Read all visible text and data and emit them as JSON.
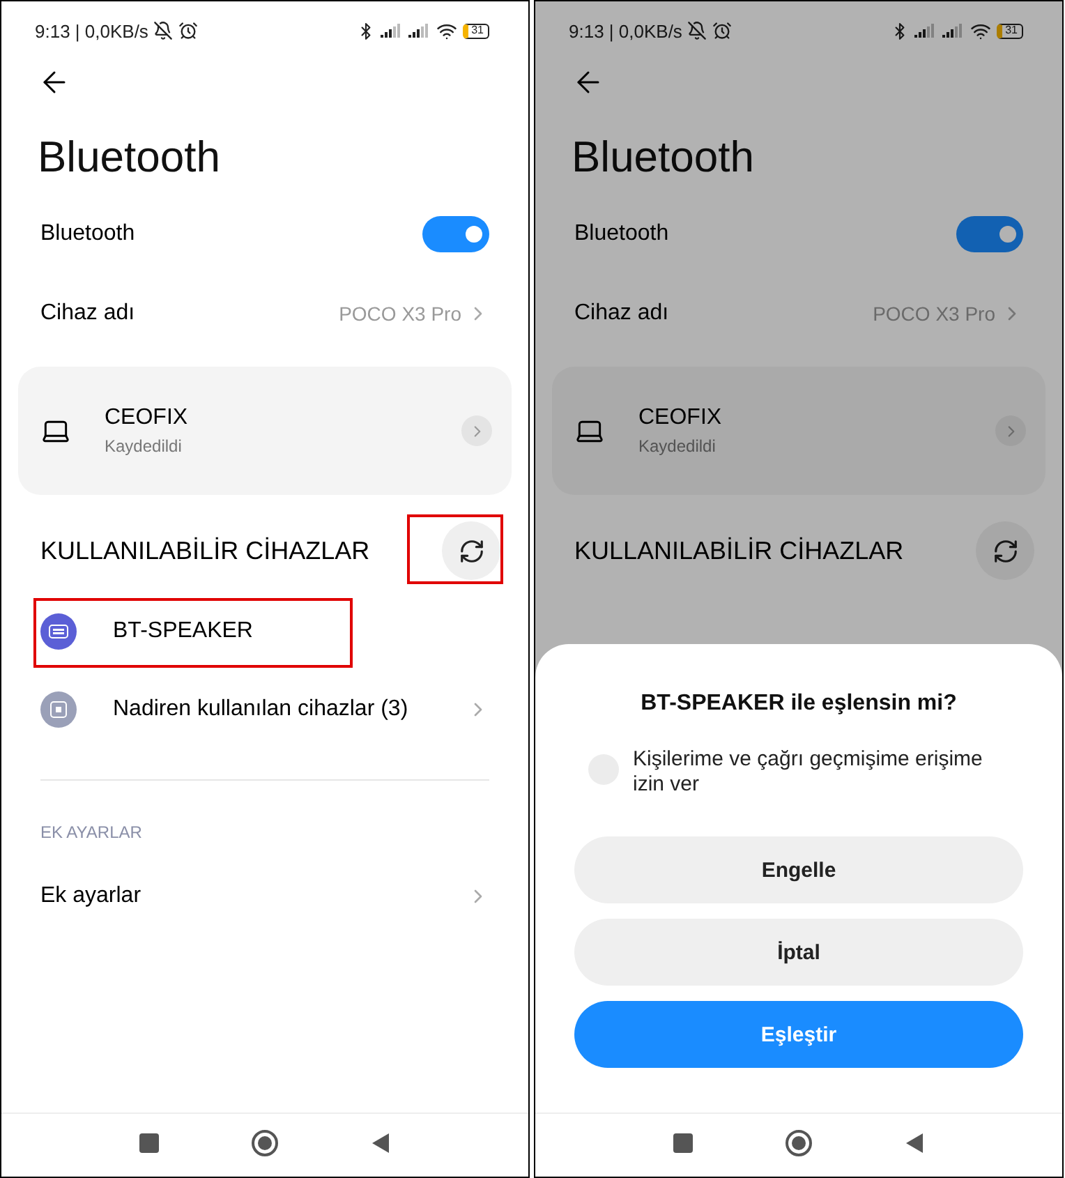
{
  "screens": [
    {
      "dimmed": false,
      "status_bar": {
        "time": "9:13 | 0,0KB/s",
        "battery": "31"
      },
      "title": "Bluetooth",
      "settings": [
        {
          "kind": "toggle",
          "label": "Bluetooth",
          "on": true
        },
        {
          "kind": "value",
          "label": "Cihaz adı",
          "value": "POCO X3 Pro"
        }
      ],
      "saved_devices": [
        {
          "name": "CEOFIX",
          "status": "Kaydedildi"
        }
      ],
      "available": {
        "title": "KULLANILABİLİR CİHAZLAR",
        "refresh_highlighted": true,
        "items": [
          {
            "kind": "device",
            "label": "BT-SPEAKER",
            "highlighted": true
          },
          {
            "kind": "group",
            "label": "Nadiren kullanılan cihazlar (3)",
            "highlighted": false
          }
        ]
      },
      "extra": {
        "title": "EK AYARLAR",
        "items": [
          "Ek ayarlar"
        ]
      }
    },
    {
      "dimmed": true,
      "status_bar": {
        "time": "9:13 | 0,0KB/s",
        "battery": "31"
      },
      "title": "Bluetooth",
      "settings": [
        {
          "kind": "toggle",
          "label": "Bluetooth",
          "on": true
        },
        {
          "kind": "value",
          "label": "Cihaz adı",
          "value": "POCO X3 Pro"
        }
      ],
      "saved_devices": [
        {
          "name": "CEOFIX",
          "status": "Kaydedildi"
        }
      ],
      "available": {
        "title": "KULLANILABİLİR CİHAZLAR"
      },
      "dialog": {
        "title": "BT-SPEAKER ile eşlensin mi?",
        "option": {
          "label": "Kişilerime ve çağrı geçmişime erişime izin ver",
          "checked": false
        },
        "buttons": [
          {
            "label": "Engelle",
            "primary": false
          },
          {
            "label": "İptal",
            "primary": false
          },
          {
            "label": "Eşleştir",
            "primary": true
          }
        ]
      }
    }
  ]
}
